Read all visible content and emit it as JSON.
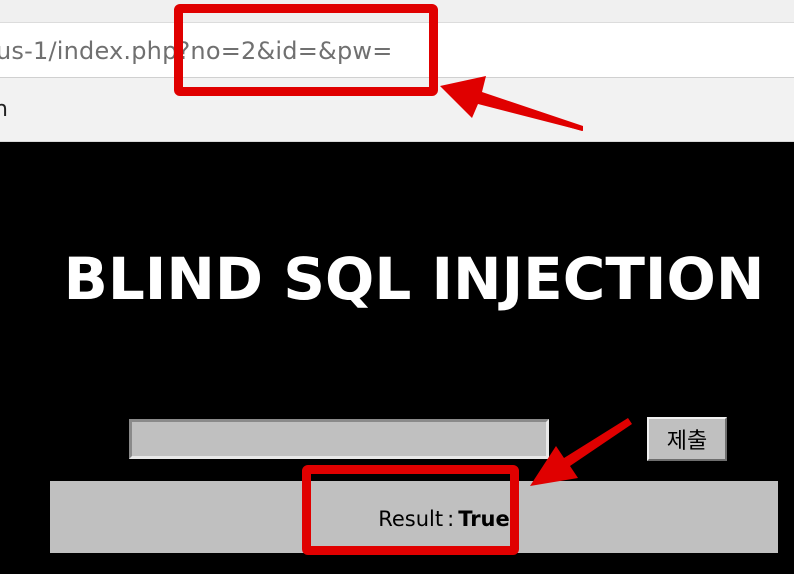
{
  "browser": {
    "url_visible": "us-1/index.php?no=2&id=&pw=",
    "bookmark_fragment": "n"
  },
  "page": {
    "title": "BLIND SQL INJECTION",
    "query_input": {
      "value": ""
    },
    "submit_label": "제출",
    "result": {
      "label": "Result",
      "separator": ":",
      "value": "True"
    }
  },
  "annotations": {
    "color": "#e00000",
    "highlights": [
      "url-query-highlight",
      "result-highlight"
    ],
    "arrows": [
      "arrow-to-url",
      "arrow-to-result"
    ]
  }
}
